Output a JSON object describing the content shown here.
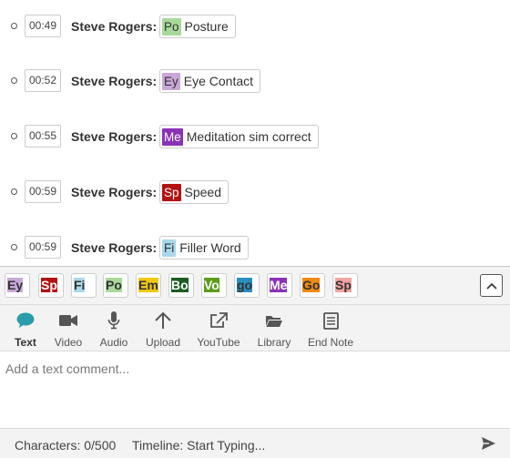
{
  "feed": {
    "entries": [
      {
        "time": "00:49",
        "author": "Steve Rogers:",
        "tag_code": "Po",
        "tag_label": "Posture",
        "tag_color": "#a8d99a",
        "tag_text_color": "#333333"
      },
      {
        "time": "00:52",
        "author": "Steve Rogers:",
        "tag_code": "Ey",
        "tag_label": "Eye Contact",
        "tag_color": "#c9a8d8",
        "tag_text_color": "#333333"
      },
      {
        "time": "00:55",
        "author": "Steve Rogers:",
        "tag_code": "Me",
        "tag_label": "Meditation sim correct",
        "tag_color": "#8b32b6",
        "tag_text_color": "#ffffff"
      },
      {
        "time": "00:59",
        "author": "Steve Rogers:",
        "tag_code": "Sp",
        "tag_label": "Speed",
        "tag_color": "#b31212",
        "tag_text_color": "#ffffff"
      },
      {
        "time": "00:59",
        "author": "Steve Rogers:",
        "tag_code": "Fi",
        "tag_label": "Filler Word",
        "tag_color": "#a8d8ea",
        "tag_text_color": "#333333"
      }
    ]
  },
  "tagbar": {
    "chips": [
      {
        "code": "Ey",
        "bg": "#c9a8d8",
        "fg": "#333333"
      },
      {
        "code": "Sp",
        "bg": "#b31212",
        "fg": "#ffffff"
      },
      {
        "code": "Fi",
        "bg": "#a8d8ea",
        "fg": "#333333"
      },
      {
        "code": "Po",
        "bg": "#a8d99a",
        "fg": "#333333"
      },
      {
        "code": "Em",
        "bg": "#f2c811",
        "fg": "#333333"
      },
      {
        "code": "Bo",
        "bg": "#1b5e20",
        "fg": "#ffffff"
      },
      {
        "code": "Vo",
        "bg": "#5a9e1a",
        "fg": "#ffffff"
      },
      {
        "code": "go",
        "bg": "#2a8fbd",
        "fg": "#333333"
      },
      {
        "code": "Me",
        "bg": "#8b32b6",
        "fg": "#ffffff"
      },
      {
        "code": "Go",
        "bg": "#ef8a12",
        "fg": "#333333"
      },
      {
        "code": "Sp",
        "bg": "#f4a3a3",
        "fg": "#333333"
      }
    ],
    "collapse_icon": "chevron-up-icon"
  },
  "tools": [
    {
      "label": "Text",
      "icon": "speech-bubble-icon",
      "active": true,
      "color": "#2a9ba8"
    },
    {
      "label": "Video",
      "icon": "video-camera-icon",
      "active": false
    },
    {
      "label": "Audio",
      "icon": "microphone-icon",
      "active": false
    },
    {
      "label": "Upload",
      "icon": "upload-arrow-icon",
      "active": false
    },
    {
      "label": "YouTube",
      "icon": "external-link-icon",
      "active": false
    },
    {
      "label": "Library",
      "icon": "folder-icon",
      "active": false
    },
    {
      "label": "End Note",
      "icon": "note-icon",
      "active": false
    }
  ],
  "comment": {
    "placeholder": "Add a text comment..."
  },
  "footer": {
    "characters": "Characters: 0/500",
    "timeline": "Timeline:  Start Typing...",
    "send_icon": "send-icon"
  }
}
